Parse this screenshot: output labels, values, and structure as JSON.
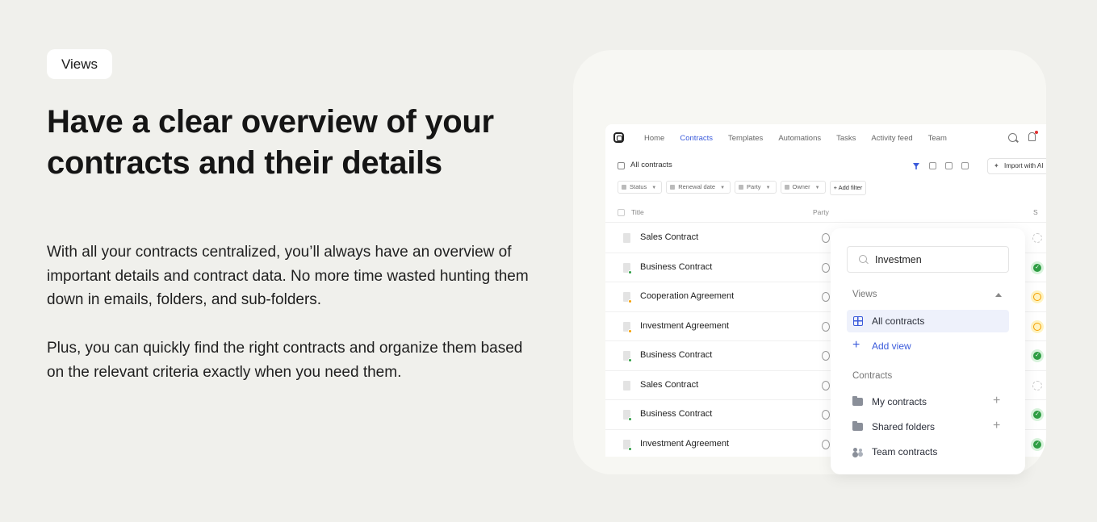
{
  "badge": "Views",
  "headline": "Have a clear overview of your contracts and their details",
  "paragraphs": {
    "p1": "With all your contracts centralized, you’ll always have an overview of important details and contract data. No more time wasted hunting them down in emails, folders, and sub-folders.",
    "p2": "Plus, you can quickly find the right contracts and organize them based on the relevant criteria exactly when you need them."
  },
  "app": {
    "nav": [
      "Home",
      "Contracts",
      "Templates",
      "Automations",
      "Tasks",
      "Activity feed",
      "Team"
    ],
    "active_nav": "Contracts",
    "toolbar": {
      "title": "All contracts",
      "import_label": "Import with AI"
    },
    "filters": [
      "Status",
      "Renewal date",
      "Party",
      "Owner"
    ],
    "add_filter": "Add filter",
    "columns": {
      "title": "Title",
      "party": "Party",
      "status": "S"
    },
    "rows": [
      {
        "title": "Sales Contract",
        "dot": "",
        "status": "grey"
      },
      {
        "title": "Business Contract",
        "dot": "#2f9e44",
        "status": "green"
      },
      {
        "title": "Cooperation Agreement",
        "dot": "#f59f00",
        "status": "yellow"
      },
      {
        "title": "Investment Agreement",
        "dot": "#f59f00",
        "status": "yellow"
      },
      {
        "title": "Business Contract",
        "dot": "#2f9e44",
        "status": "green"
      },
      {
        "title": "Sales Contract",
        "dot": "",
        "status": "grey"
      },
      {
        "title": "Business Contract",
        "dot": "#2f9e44",
        "status": "green"
      },
      {
        "title": "Investment Agreement",
        "dot": "#2f9e44",
        "status": "green"
      }
    ]
  },
  "popup": {
    "search_value": "Investmen",
    "views_heading": "Views",
    "all_contracts": "All contracts",
    "add_view": "Add view",
    "contracts_heading": "Contracts",
    "my_contracts": "My contracts",
    "shared_folders": "Shared folders",
    "team_contracts": "Team contracts"
  },
  "colors": {
    "accent": "#3b5bdb",
    "background": "#f0f0ec",
    "success": "#2f9e44",
    "warning": "#f59f00"
  }
}
